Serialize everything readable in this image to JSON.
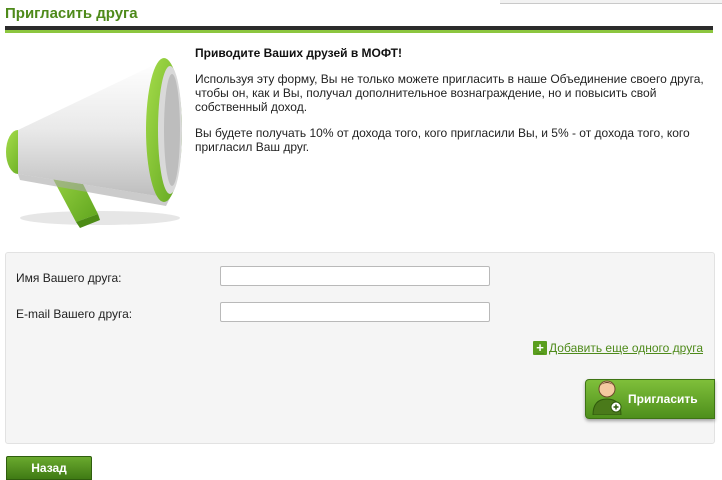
{
  "page": {
    "title": "Пригласить друга"
  },
  "intro": {
    "heading": "Приводите Ваших друзей в МОФТ!",
    "paragraph1": "Используя эту форму, Вы не только можете пригласить в наше Объединение своего друга, чтобы он, как и Вы, получал дополнительное вознаграждение, но и повысить свой собственный доход.",
    "paragraph2": "Вы будете получать 10% от дохода того, кого пригласили Вы, и 5% - от дохода того, кого пригласил Ваш друг."
  },
  "form": {
    "name_label": "Имя Вашего друга:",
    "name_value": "",
    "email_label": "E-mail Вашего друга:",
    "email_value": "",
    "add_friend_link": "Добавить еще одного друга",
    "invite_button": "Пригласить"
  },
  "footer": {
    "back_button": "Назад"
  },
  "colors": {
    "accent": "#8cc63f",
    "title": "#4e8a1a",
    "button": "#5a9e1e"
  },
  "icons": [
    "megaphone-illustration",
    "plus-icon",
    "user-add-icon"
  ]
}
